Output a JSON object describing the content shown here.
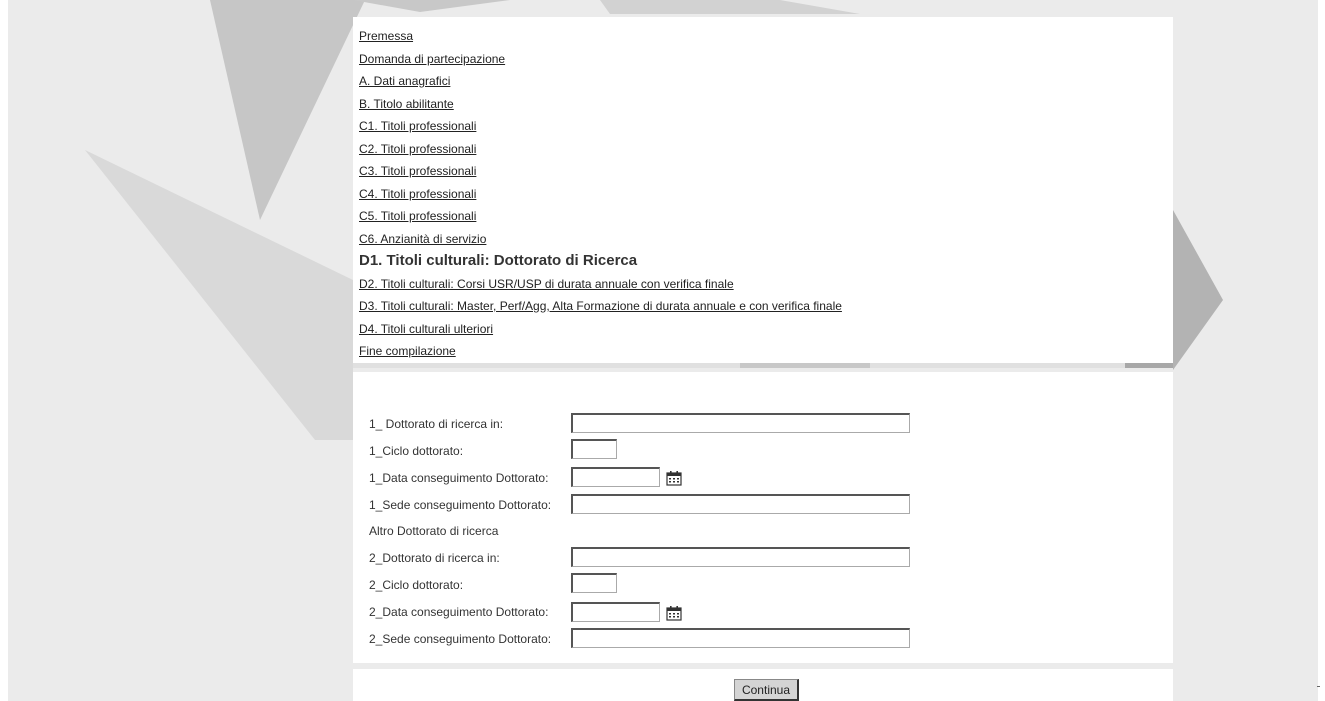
{
  "nav": {
    "items": [
      {
        "label": "Premessa"
      },
      {
        "label": "Domanda di partecipazione"
      },
      {
        "label": "A. Dati anagrafici"
      },
      {
        "label": "B. Titolo abilitante"
      },
      {
        "label": "C1. Titoli professionali"
      },
      {
        "label": "C2. Titoli professionali"
      },
      {
        "label": "C3. Titoli professionali"
      },
      {
        "label": "C4. Titoli professionali"
      },
      {
        "label": "C5. Titoli professionali"
      },
      {
        "label": "C6. Anzianità di servizio"
      },
      {
        "label": "D1. Titoli culturali: Dottorato di Ricerca",
        "current": true
      },
      {
        "label": "D2. Titoli culturali: Corsi USR/USP di durata annuale con verifica finale"
      },
      {
        "label": "D3. Titoli culturali: Master, Perf/Agg, Alta Formazione di durata annuale e con verifica finale"
      },
      {
        "label": "D4. Titoli culturali ulteriori"
      },
      {
        "label": "Fine compilazione"
      }
    ]
  },
  "form": {
    "dottorato1_label": "1_ Dottorato di ricerca in:",
    "dottorato1_value": "",
    "ciclo1_label": "1_Ciclo dottorato:",
    "ciclo1_value": "",
    "data1_label": "1_Data conseguimento Dottorato:",
    "data1_value": "",
    "sede1_label": "1_Sede conseguimento Dottorato:",
    "sede1_value": "",
    "altro_label": "Altro Dottorato di ricerca",
    "dottorato2_label": "2_Dottorato di ricerca in:",
    "dottorato2_value": "",
    "ciclo2_label": "2_Ciclo dottorato:",
    "ciclo2_value": "",
    "data2_label": "2_Data conseguimento Dottorato:",
    "data2_value": "",
    "sede2_label": "2_Sede conseguimento Dottorato:",
    "sede2_value": ""
  },
  "footer": {
    "continue_label": "Continua"
  },
  "icons": {
    "calendar": "calendar-icon"
  },
  "colors": {
    "background": "#ebebeb",
    "panel": "#ffffff",
    "shape_dark": "#b0b0b0",
    "shape_light": "#d8d8d8"
  }
}
